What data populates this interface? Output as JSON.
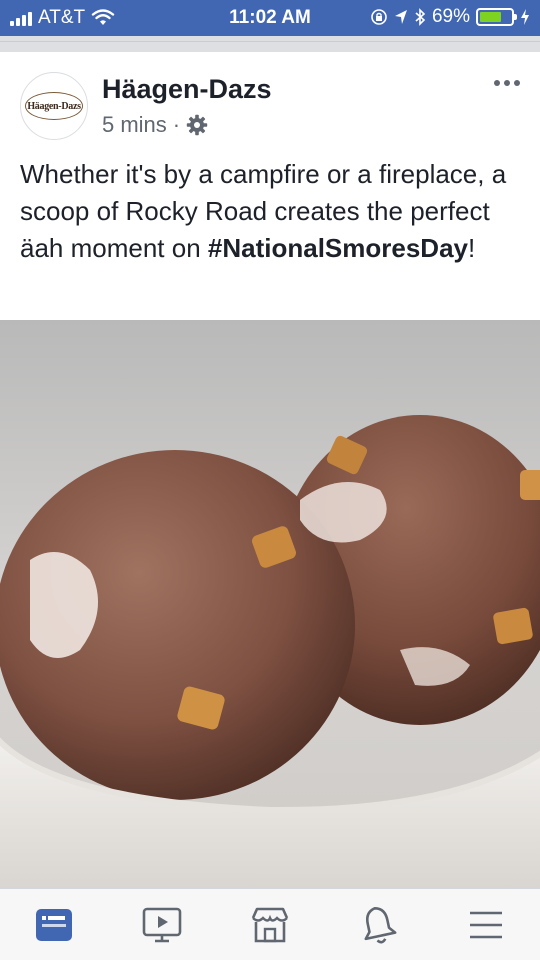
{
  "status_bar": {
    "carrier": "AT&T",
    "time": "11:02 AM",
    "battery_percent": "69%",
    "battery_level": 0.69,
    "signal_bars": 4,
    "icons": [
      "wifi-icon",
      "orientation-lock-icon",
      "location-icon",
      "bluetooth-icon",
      "charging-icon"
    ]
  },
  "post": {
    "page_name": "Häagen-Dazs",
    "logo_text": "Häagen-Dazs",
    "timestamp": "5 mins",
    "separator": "·",
    "audience_icon": "gear-icon",
    "text_before_hashtag": "Whether it's by a campfire or a fireplace, a scoop of Rocky Road creates the perfect äah moment on ",
    "hashtag": "#NationalSmoresDay",
    "text_after_hashtag": "!",
    "image_alt": "photo"
  },
  "tabbar": {
    "items": [
      {
        "name": "news-feed",
        "icon": "news-feed-icon",
        "active": true
      },
      {
        "name": "watch",
        "icon": "video-icon",
        "active": false
      },
      {
        "name": "marketplace",
        "icon": "marketplace-icon",
        "active": false
      },
      {
        "name": "notifications",
        "icon": "bell-icon",
        "active": false
      },
      {
        "name": "menu",
        "icon": "menu-icon",
        "active": false
      }
    ]
  },
  "colors": {
    "brand_blue": "#4267b2",
    "active_tab": "#4267b2",
    "inactive_tab": "#606770",
    "battery_fill": "#7ed321"
  }
}
